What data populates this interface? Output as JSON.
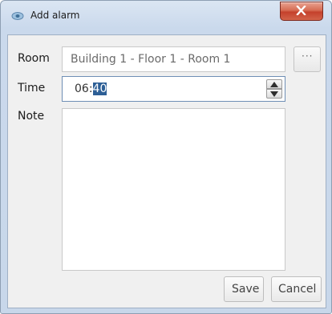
{
  "window": {
    "title": "Add alarm",
    "close_glyph": "X"
  },
  "form": {
    "room_label": "Room",
    "room_value": "Building 1 - Floor 1 - Room 1",
    "browse_label": "···",
    "time_label": "Time",
    "time_hours": "06:",
    "time_minutes_selected": "40",
    "note_label": "Note",
    "note_value": ""
  },
  "buttons": {
    "save": "Save",
    "cancel": "Cancel"
  },
  "colors": {
    "selection": "#2d5f96",
    "close_button": "#c4412c",
    "title_bar": "#cad9ec"
  },
  "icons": [
    "app-icon",
    "close-icon",
    "spin-up-arrow-icon",
    "spin-down-arrow-icon"
  ]
}
